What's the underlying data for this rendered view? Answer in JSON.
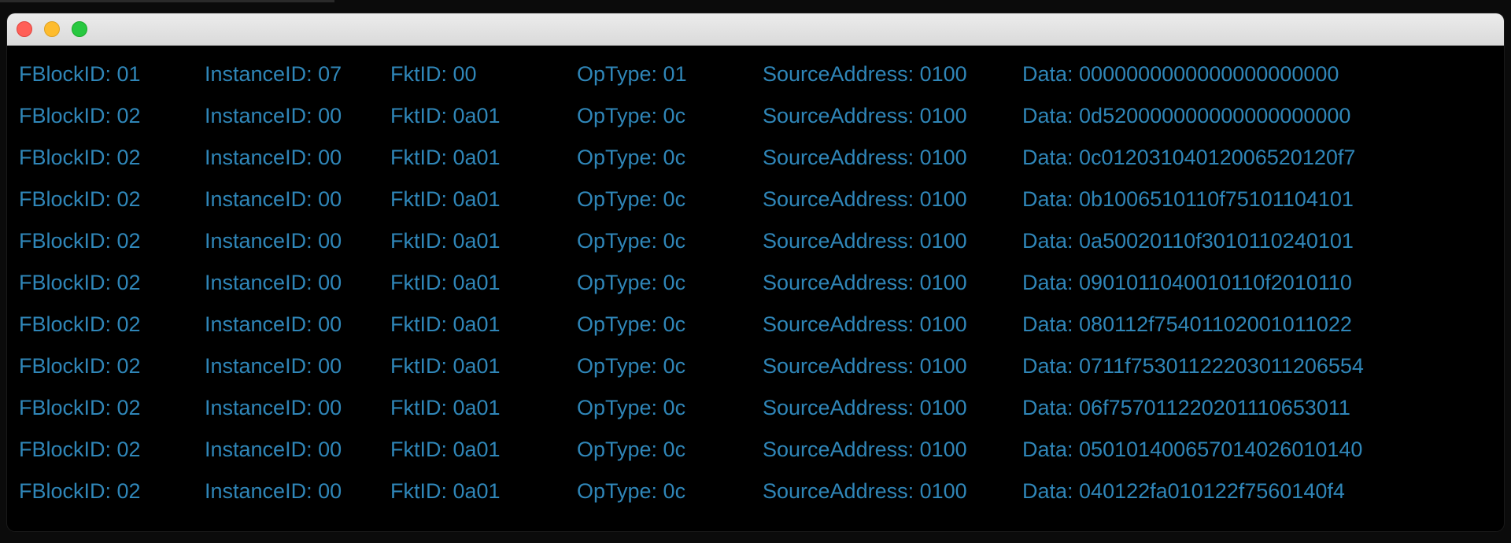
{
  "window": {
    "buttons": [
      "close",
      "minimize",
      "zoom"
    ]
  },
  "rows": [
    {
      "fblock": "FBlockID: 01",
      "instance": "InstanceID: 07",
      "fkt": "FktID: 00",
      "optype": "OpType: 01",
      "source": "SourceAddress: 0100",
      "data": "Data: 0000000000000000000000"
    },
    {
      "fblock": "FBlockID: 02",
      "instance": "InstanceID: 00",
      "fkt": "FktID: 0a01",
      "optype": "OpType: 0c",
      "source": "SourceAddress: 0100",
      "data": "Data: 0d520000000000000000000"
    },
    {
      "fblock": "FBlockID: 02",
      "instance": "InstanceID: 00",
      "fkt": "FktID: 0a01",
      "optype": "OpType: 0c",
      "source": "SourceAddress: 0100",
      "data": "Data: 0c01203104012006520120f7"
    },
    {
      "fblock": "FBlockID: 02",
      "instance": "InstanceID: 00",
      "fkt": "FktID: 0a01",
      "optype": "OpType: 0c",
      "source": "SourceAddress: 0100",
      "data": "Data: 0b1006510110f75101104101"
    },
    {
      "fblock": "FBlockID: 02",
      "instance": "InstanceID: 00",
      "fkt": "FktID: 0a01",
      "optype": "OpType: 0c",
      "source": "SourceAddress: 0100",
      "data": "Data: 0a50020110f3010110240101"
    },
    {
      "fblock": "FBlockID: 02",
      "instance": "InstanceID: 00",
      "fkt": "FktID: 0a01",
      "optype": "OpType: 0c",
      "source": "SourceAddress: 0100",
      "data": "Data: 0901011040010110f2010110"
    },
    {
      "fblock": "FBlockID: 02",
      "instance": "InstanceID: 00",
      "fkt": "FktID: 0a01",
      "optype": "OpType: 0c",
      "source": "SourceAddress: 0100",
      "data": "Data: 080112f75401102001011022"
    },
    {
      "fblock": "FBlockID: 02",
      "instance": "InstanceID: 00",
      "fkt": "FktID: 0a01",
      "optype": "OpType: 0c",
      "source": "SourceAddress: 0100",
      "data": "Data: 0711f75301122203011206554"
    },
    {
      "fblock": "FBlockID: 02",
      "instance": "InstanceID: 00",
      "fkt": "FktID: 0a01",
      "optype": "OpType: 0c",
      "source": "SourceAddress: 0100",
      "data": "Data: 06f757011220201110653011"
    },
    {
      "fblock": "FBlockID: 02",
      "instance": "InstanceID: 00",
      "fkt": "FktID: 0a01",
      "optype": "OpType: 0c",
      "source": "SourceAddress: 0100",
      "data": "Data: 050101400657014026010140"
    },
    {
      "fblock": "FBlockID: 02",
      "instance": "InstanceID: 00",
      "fkt": "FktID: 0a01",
      "optype": "OpType: 0c",
      "source": "SourceAddress: 0100",
      "data": "Data: 040122fa010122f7560140f4"
    }
  ]
}
